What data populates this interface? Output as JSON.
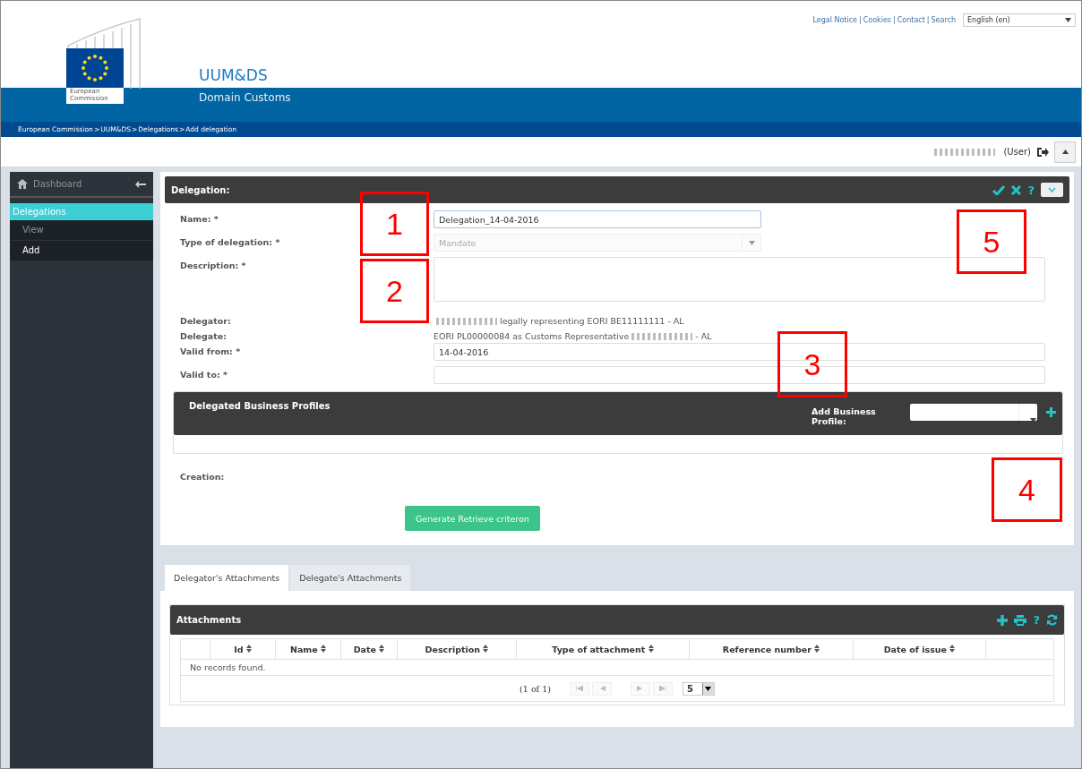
{
  "header": {
    "logo_text": "European Commission",
    "app_title": "UUM&DS",
    "app_subtitle": "Domain Customs",
    "top_links": [
      "Legal Notice",
      "Cookies",
      "Contact",
      "Search"
    ],
    "link_separators": [
      "|",
      "|",
      "|"
    ],
    "language": "English (en)"
  },
  "breadcrumb": [
    "European Commission",
    "UUM&DS",
    "Delegations",
    "Add delegation"
  ],
  "breadcrumb_separators": [
    ">",
    ">",
    ">"
  ],
  "user": {
    "role": "(User)"
  },
  "sidebar": {
    "dashboard": "Dashboard",
    "items": [
      {
        "label": "Delegations",
        "selected": true,
        "children": [
          {
            "label": "View",
            "selected": false
          },
          {
            "label": "Add",
            "selected": true
          }
        ]
      }
    ]
  },
  "form": {
    "title": "Delegation:",
    "help_glyph": "?",
    "fields": [
      {
        "kind": "input",
        "label": "Name: *",
        "value": "Delegation_14-04-2016"
      },
      {
        "kind": "select",
        "label": "Type of delegation: *",
        "placeholder": "Mandate",
        "disabled": true
      },
      {
        "kind": "textarea",
        "label": "Description: *"
      },
      {
        "kind": "text",
        "label": "Delegator:",
        "value": "legally representing EORI BE11111111 - AL",
        "redacted_before": true
      },
      {
        "kind": "text",
        "label": "Delegate:",
        "value": "EORI PL00000084 as Customs Representative",
        "suffix": "- AL",
        "redacted_after": true
      },
      {
        "kind": "wide-input",
        "label": "Valid from: *",
        "value": "14-04-2016"
      },
      {
        "kind": "wide-input",
        "label": "Valid to: *"
      }
    ],
    "profiles": {
      "title": "Delegated Business Profiles",
      "add_label": "Add Business Profile:"
    },
    "creation_label": "Creation:",
    "generate_button": "Generate Retrieve criteron"
  },
  "tabs": [
    {
      "label": "Delegator's Attachments",
      "selected": true
    },
    {
      "label": "Delegate's Attachments",
      "selected": false
    }
  ],
  "attachments": {
    "title": "Attachments",
    "help_glyph": "?",
    "columns": [
      "Id",
      "Name",
      "Date",
      "Description",
      "Type of attachment",
      "Reference number",
      "Date of issue"
    ],
    "empty": "No records found.",
    "page_info": "(1 of 1)",
    "rows_per_page": "5"
  },
  "annotations": [
    "1",
    "2",
    "3",
    "4",
    "5"
  ]
}
